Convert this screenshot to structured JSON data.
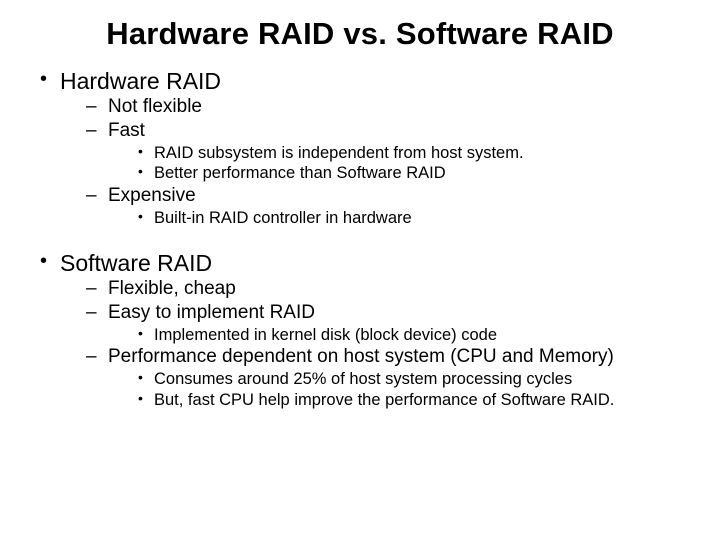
{
  "title": "Hardware RAID vs. Software RAID",
  "sections": [
    {
      "heading": "Hardware RAID",
      "points": [
        {
          "text": "Not flexible",
          "sub": []
        },
        {
          "text": "Fast",
          "sub": [
            "RAID subsystem is independent from host system.",
            "Better performance than Software RAID"
          ]
        },
        {
          "text": "Expensive",
          "sub": [
            "Built-in RAID controller in hardware"
          ]
        }
      ]
    },
    {
      "heading": "Software RAID",
      "points": [
        {
          "text": "Flexible, cheap",
          "sub": []
        },
        {
          "text": "Easy to implement RAID",
          "sub": [
            "Implemented in kernel disk (block device) code"
          ]
        },
        {
          "text": "Performance dependent on host system (CPU and Memory)",
          "sub": [
            "Consumes around 25% of host system processing cycles",
            "But, fast CPU help improve the performance of Software RAID."
          ]
        }
      ]
    }
  ]
}
